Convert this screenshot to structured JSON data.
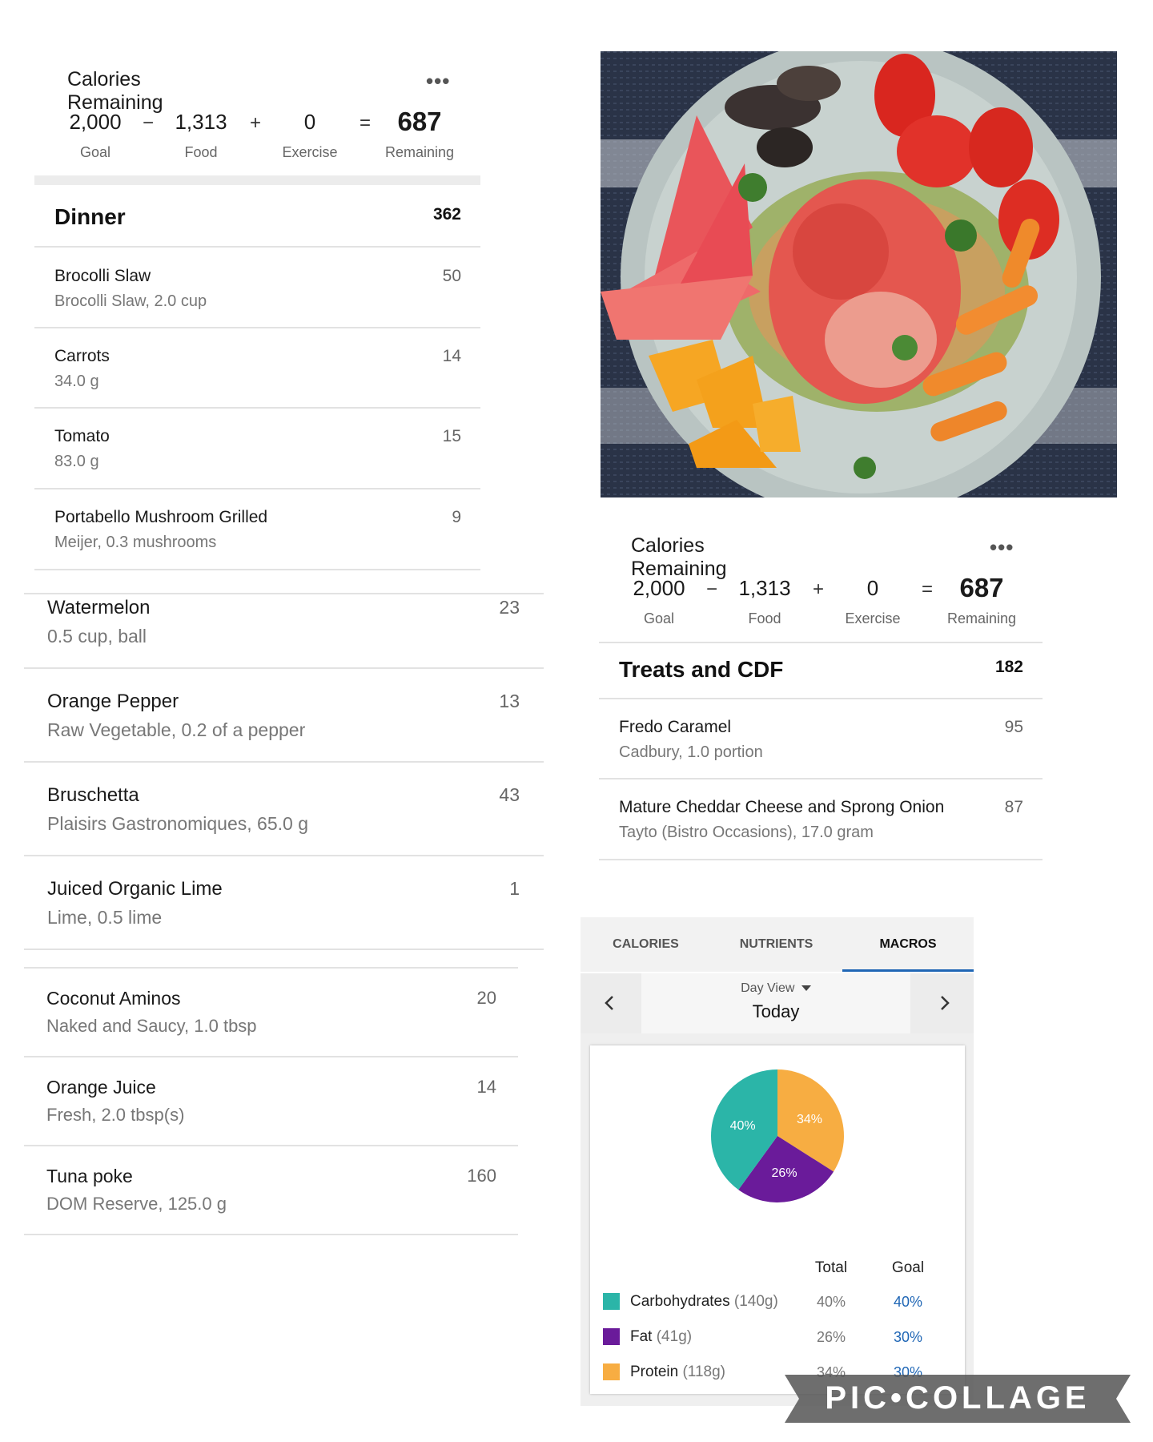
{
  "summary": {
    "title": "Calories Remaining",
    "more": "•••",
    "goal": "2,000",
    "goal_label": "Goal",
    "minus": "−",
    "food": "1,313",
    "food_label": "Food",
    "plus": "+",
    "exercise": "0",
    "exercise_label": "Exercise",
    "equals": "=",
    "remaining": "687",
    "remaining_label": "Remaining"
  },
  "dinner": {
    "title": "Dinner",
    "calories": "362",
    "items": [
      {
        "name": "Brocolli Slaw",
        "desc": "Brocolli Slaw, 2.0 cup",
        "cal": "50"
      },
      {
        "name": "Carrots",
        "desc": "34.0 g",
        "cal": "14"
      },
      {
        "name": "Tomato",
        "desc": "83.0 g",
        "cal": "15"
      },
      {
        "name": "Portabello Mushroom Grilled",
        "desc": "Meijer, 0.3 mushrooms",
        "cal": "9"
      }
    ]
  },
  "dinner_more": [
    {
      "name": "Watermelon",
      "desc": "0.5 cup, ball",
      "cal": "23"
    },
    {
      "name": "Orange Pepper",
      "desc": "Raw Vegetable, 0.2 of a pepper",
      "cal": "13"
    },
    {
      "name": "Bruschetta",
      "desc": "Plaisirs Gastronomiques, 65.0 g",
      "cal": "43"
    },
    {
      "name": "Juiced Organic Lime",
      "desc": "Lime, 0.5 lime",
      "cal": "1"
    }
  ],
  "dinner_more2": [
    {
      "name": "Coconut Aminos",
      "desc": "Naked and Saucy, 1.0 tbsp",
      "cal": "20"
    },
    {
      "name": "Orange Juice",
      "desc": "Fresh, 2.0 tbsp(s)",
      "cal": "14"
    },
    {
      "name": "Tuna poke",
      "desc": "DOM Reserve, 125.0 g",
      "cal": "160"
    }
  ],
  "treats": {
    "title": "Treats and CDF",
    "calories": "182",
    "items": [
      {
        "name": "Fredo Caramel",
        "desc": "Cadbury, 1.0 portion",
        "cal": "95"
      },
      {
        "name": "Mature Cheddar Cheese and Sprong Onion",
        "desc": "Tayto (Bistro Occasions), 17.0 gram",
        "cal": "87"
      }
    ]
  },
  "macros": {
    "tabs": [
      "CALORIES",
      "NUTRIENTS",
      "MACROS"
    ],
    "active_tab": "MACROS",
    "view_label": "Day View",
    "view_value": "Today",
    "prev_icon": "chevron-left-icon",
    "next_icon": "chevron-right-icon",
    "total_header": "Total",
    "goal_header": "Goal",
    "rows": [
      {
        "name": "Carbohydrates",
        "grams": "(140g)",
        "total": "40%",
        "goal": "40%",
        "color": "#2bb5a8"
      },
      {
        "name": "Fat",
        "grams": "(41g)",
        "total": "26%",
        "goal": "30%",
        "color": "#6a1b9a"
      },
      {
        "name": "Protein",
        "grams": "(118g)",
        "total": "34%",
        "goal": "30%",
        "color": "#f7ad42"
      }
    ]
  },
  "chart_data": {
    "type": "pie",
    "categories": [
      "Carbohydrates",
      "Fat",
      "Protein"
    ],
    "values": [
      40,
      26,
      34
    ],
    "labels": [
      "40%",
      "26%",
      "34%"
    ],
    "colors": [
      "#2bb5a8",
      "#6a1b9a",
      "#f7ad42"
    ]
  },
  "watermark": "PIC•COLLAGE"
}
